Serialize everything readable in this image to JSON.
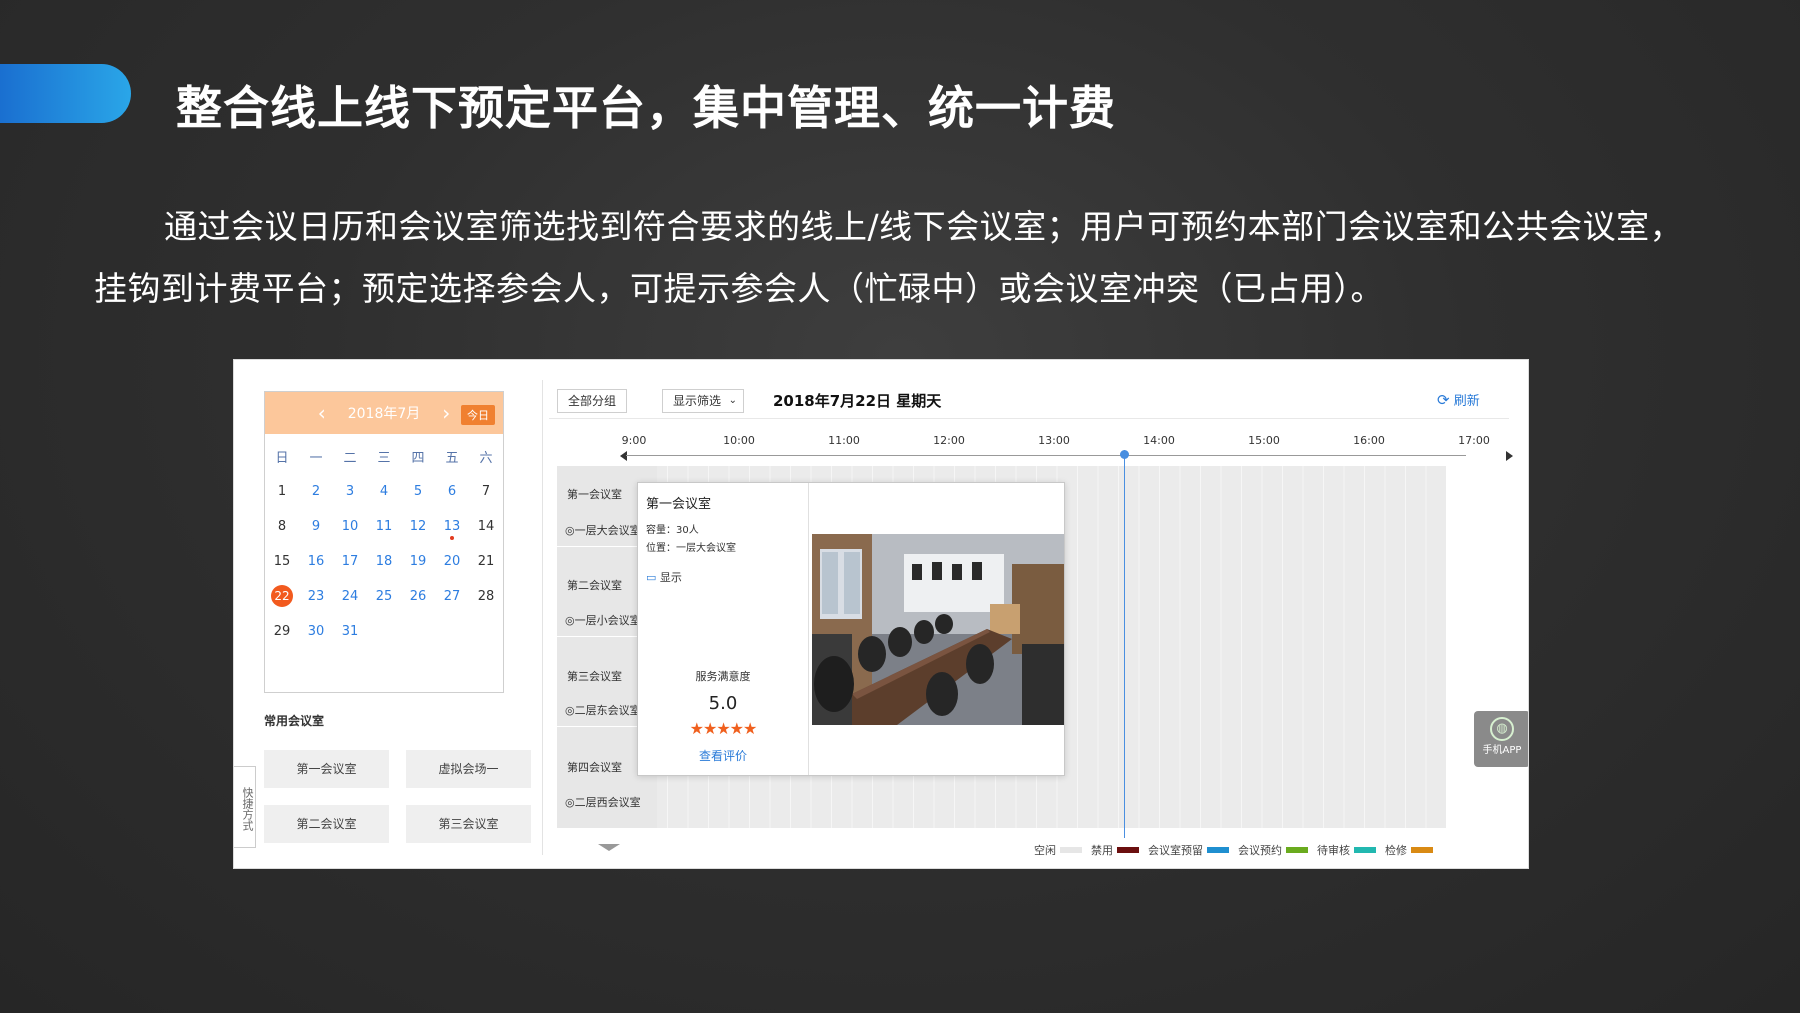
{
  "slide": {
    "title": "整合线上线下预定平台，集中管理、统一计费",
    "description": "通过会议日历和会议室筛选找到符合要求的线上/线下会议室；用户可预约本部门会议室和公共会议室，挂钩到计费平台；预定选择参会人，可提示参会人（忙碌中）或会议室冲突（已占用）。"
  },
  "calendar": {
    "month_label": "2018年7月",
    "today_label": "今日",
    "weekdays": [
      "日",
      "一",
      "二",
      "三",
      "四",
      "五",
      "六"
    ],
    "weeks": [
      [
        "1",
        "2",
        "3",
        "4",
        "5",
        "6",
        "7"
      ],
      [
        "8",
        "9",
        "10",
        "11",
        "12",
        "13",
        "14"
      ],
      [
        "15",
        "16",
        "17",
        "18",
        "19",
        "20",
        "21"
      ],
      [
        "22",
        "23",
        "24",
        "25",
        "26",
        "27",
        "28"
      ],
      [
        "29",
        "30",
        "31",
        "",
        "",
        "",
        ""
      ]
    ],
    "selected_day": "22",
    "marked_day": "13"
  },
  "favorites": {
    "title": "常用会议室",
    "rooms": [
      "第一会议室",
      "虚拟会场一",
      "第二会议室",
      "第三会议室"
    ]
  },
  "shortcut_label": "快捷方式",
  "toolbar": {
    "group_btn": "全部分组",
    "filter_btn": "显示筛选",
    "date_title": "2018年7月22日    星期天",
    "refresh_label": "刷新"
  },
  "timeline": {
    "times": [
      "9:00",
      "10:00",
      "11:00",
      "12:00",
      "13:00",
      "14:00",
      "15:00",
      "16:00",
      "17:00"
    ],
    "rooms": [
      {
        "name": "第一会议室",
        "location": "一层大会议室"
      },
      {
        "name": "第二会议室",
        "location": "一层小会议室"
      },
      {
        "name": "第三会议室",
        "location": "二层东会议室"
      },
      {
        "name": "第四会议室",
        "location": "二层西会议室"
      }
    ]
  },
  "popup": {
    "room_name": "第一会议室",
    "capacity": "容量：30人",
    "location": "位置：一层大会议室",
    "display": "显示",
    "satisfaction_label": "服务满意度",
    "score": "5.0",
    "stars": "★★★★★",
    "view_reviews": "查看评价"
  },
  "legend": [
    {
      "label": "空闲",
      "color": "#e6e6e6"
    },
    {
      "label": "禁用",
      "color": "#6b0f0f"
    },
    {
      "label": "会议室预留",
      "color": "#1f8fd0"
    },
    {
      "label": "会议预约",
      "color": "#6aab1e"
    },
    {
      "label": "待审核",
      "color": "#22b8b0"
    },
    {
      "label": "检修",
      "color": "#d98a14"
    }
  ],
  "app_button": {
    "label": "手机APP",
    "icon": "phone-app-icon"
  }
}
